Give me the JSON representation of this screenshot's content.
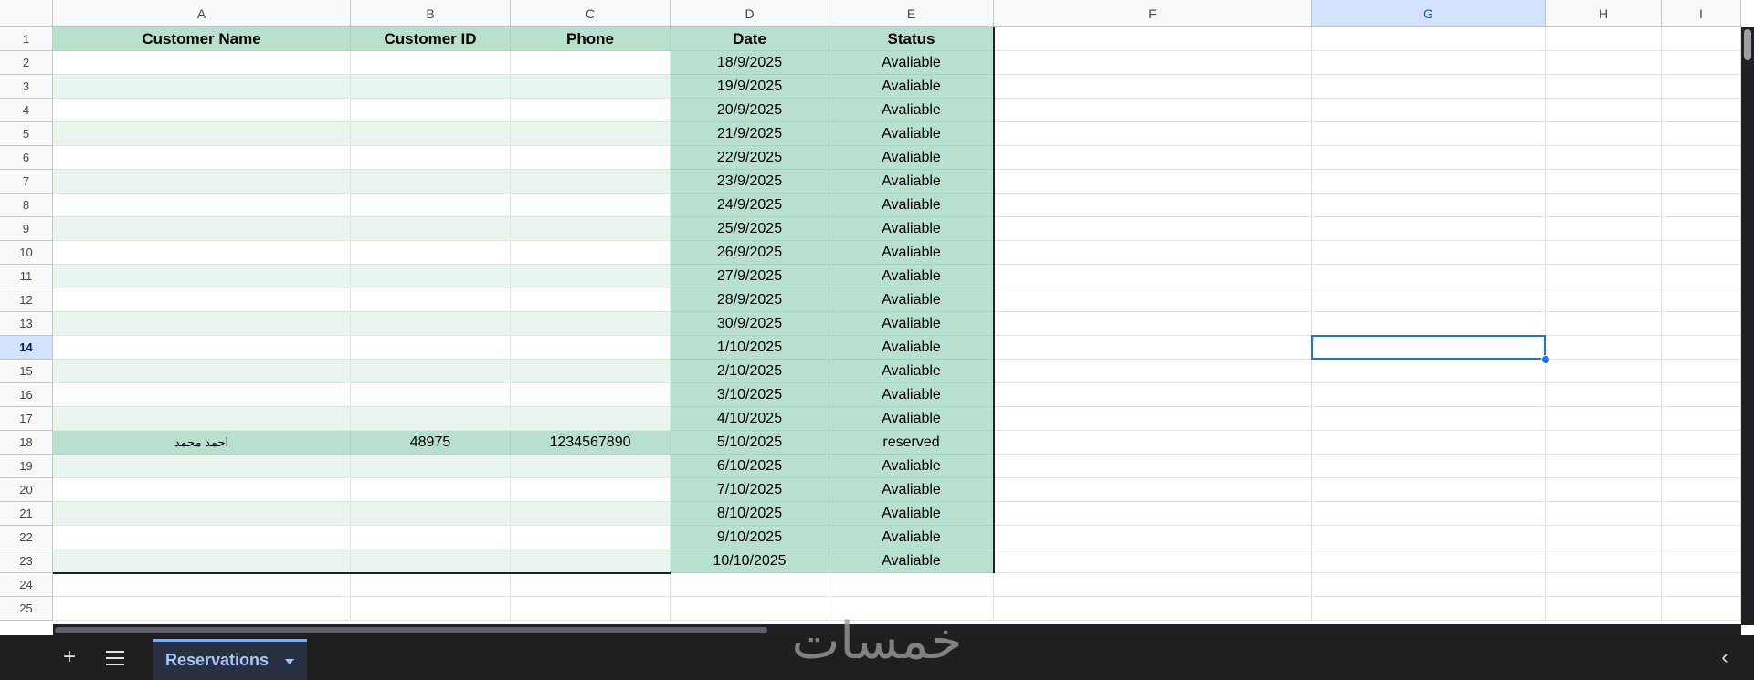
{
  "columns": [
    "A",
    "B",
    "C",
    "D",
    "E",
    "F",
    "G",
    "H",
    "I"
  ],
  "row_numbers": [
    "1",
    "2",
    "3",
    "4",
    "5",
    "6",
    "7",
    "8",
    "9",
    "10",
    "11",
    "12",
    "13",
    "14",
    "15",
    "16",
    "17",
    "18",
    "19",
    "20",
    "21",
    "22",
    "23",
    "24",
    "25"
  ],
  "selected_cell": {
    "column": "G",
    "row": "14"
  },
  "header_row": {
    "customer_name": "Customer Name",
    "customer_id": "Customer ID",
    "phone": "Phone",
    "date": "Date",
    "status": "Status"
  },
  "rows": [
    {
      "name": "",
      "id": "",
      "phone": "",
      "date": "18/9/2025",
      "status": "Avaliable"
    },
    {
      "name": "",
      "id": "",
      "phone": "",
      "date": "19/9/2025",
      "status": "Avaliable"
    },
    {
      "name": "",
      "id": "",
      "phone": "",
      "date": "20/9/2025",
      "status": "Avaliable"
    },
    {
      "name": "",
      "id": "",
      "phone": "",
      "date": "21/9/2025",
      "status": "Avaliable"
    },
    {
      "name": "",
      "id": "",
      "phone": "",
      "date": "22/9/2025",
      "status": "Avaliable"
    },
    {
      "name": "",
      "id": "",
      "phone": "",
      "date": "23/9/2025",
      "status": "Avaliable"
    },
    {
      "name": "",
      "id": "",
      "phone": "",
      "date": "24/9/2025",
      "status": "Avaliable"
    },
    {
      "name": "",
      "id": "",
      "phone": "",
      "date": "25/9/2025",
      "status": "Avaliable"
    },
    {
      "name": "",
      "id": "",
      "phone": "",
      "date": "26/9/2025",
      "status": "Avaliable"
    },
    {
      "name": "",
      "id": "",
      "phone": "",
      "date": "27/9/2025",
      "status": "Avaliable"
    },
    {
      "name": "",
      "id": "",
      "phone": "",
      "date": "28/9/2025",
      "status": "Avaliable"
    },
    {
      "name": "",
      "id": "",
      "phone": "",
      "date": "30/9/2025",
      "status": "Avaliable"
    },
    {
      "name": "",
      "id": "",
      "phone": "",
      "date": "1/10/2025",
      "status": "Avaliable"
    },
    {
      "name": "",
      "id": "",
      "phone": "",
      "date": "2/10/2025",
      "status": "Avaliable"
    },
    {
      "name": "",
      "id": "",
      "phone": "",
      "date": "3/10/2025",
      "status": "Avaliable"
    },
    {
      "name": "",
      "id": "",
      "phone": "",
      "date": "4/10/2025",
      "status": "Avaliable"
    },
    {
      "name": "احمد محمد",
      "id": "48975",
      "phone": "1234567890",
      "date": "5/10/2025",
      "status": "reserved"
    },
    {
      "name": "",
      "id": "",
      "phone": "",
      "date": "6/10/2025",
      "status": "Avaliable"
    },
    {
      "name": "",
      "id": "",
      "phone": "",
      "date": "7/10/2025",
      "status": "Avaliable"
    },
    {
      "name": "",
      "id": "",
      "phone": "",
      "date": "8/10/2025",
      "status": "Avaliable"
    },
    {
      "name": "",
      "id": "",
      "phone": "",
      "date": "9/10/2025",
      "status": "Avaliable"
    },
    {
      "name": "",
      "id": "",
      "phone": "",
      "date": "10/10/2025",
      "status": "Avaliable"
    }
  ],
  "bottom_bar": {
    "add_sheet_icon": "plus-icon",
    "all_sheets_icon": "menu-icon",
    "active_tab": "Reservations",
    "collapse_icon": "chevron-left-icon"
  },
  "watermark_text": "خمسات",
  "colors": {
    "table_band_dark": "#b7e1cd",
    "table_band_light": "#e8f6ee",
    "selection": "#1a73e8",
    "tab_accent": "#7cacf8"
  }
}
